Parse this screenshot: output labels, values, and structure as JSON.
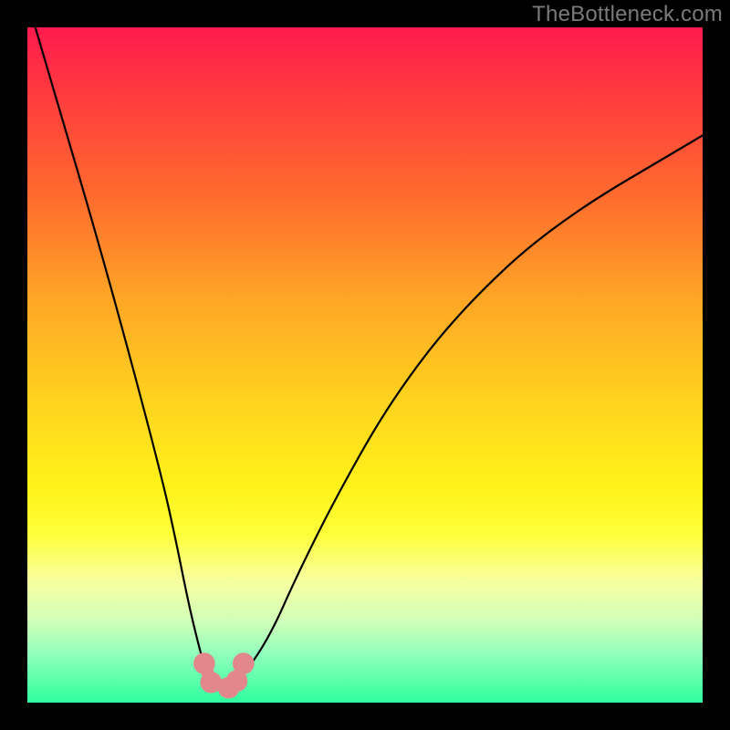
{
  "watermark": "TheBottleneck.com",
  "chart_data": {
    "type": "line",
    "title": "",
    "xlabel": "",
    "ylabel": "",
    "xlim": [
      0,
      100
    ],
    "ylim": [
      0,
      100
    ],
    "grid": false,
    "series": [
      {
        "name": "bottleneck-curve",
        "x": [
          0,
          5,
          10,
          15,
          20,
          22,
          24,
          26,
          27,
          28,
          29,
          30,
          32,
          36,
          40,
          46,
          54,
          64,
          78,
          100
        ],
        "y": [
          104,
          87,
          70,
          52,
          33,
          24,
          14,
          6,
          3,
          2,
          2,
          2,
          4,
          10,
          19,
          31,
          45,
          58,
          71,
          84
        ]
      }
    ],
    "markers": [
      {
        "name": "marker-1",
        "x": 26.2,
        "y": 5.8,
        "color": "#e2878b",
        "r": 1.6
      },
      {
        "name": "marker-2",
        "x": 27.2,
        "y": 3.0,
        "color": "#e2878b",
        "r": 1.6
      },
      {
        "name": "marker-3",
        "x": 29.8,
        "y": 2.2,
        "color": "#e2878b",
        "r": 1.6
      },
      {
        "name": "marker-4",
        "x": 31.0,
        "y": 3.2,
        "color": "#e2878b",
        "r": 1.6
      },
      {
        "name": "marker-5",
        "x": 32.0,
        "y": 5.8,
        "color": "#e2878b",
        "r": 1.6
      }
    ],
    "marker_segments": [
      {
        "from": 0,
        "to": 1
      },
      {
        "from": 1,
        "to": 2
      },
      {
        "from": 2,
        "to": 3
      },
      {
        "from": 3,
        "to": 4
      }
    ],
    "gradient_stops": [
      {
        "pct": 0,
        "color": "#ff1a4e"
      },
      {
        "pct": 25,
        "color": "#ff6b2e"
      },
      {
        "pct": 55,
        "color": "#ffd21e"
      },
      {
        "pct": 75,
        "color": "#ffff3a"
      },
      {
        "pct": 100,
        "color": "#2fff9e"
      }
    ]
  }
}
